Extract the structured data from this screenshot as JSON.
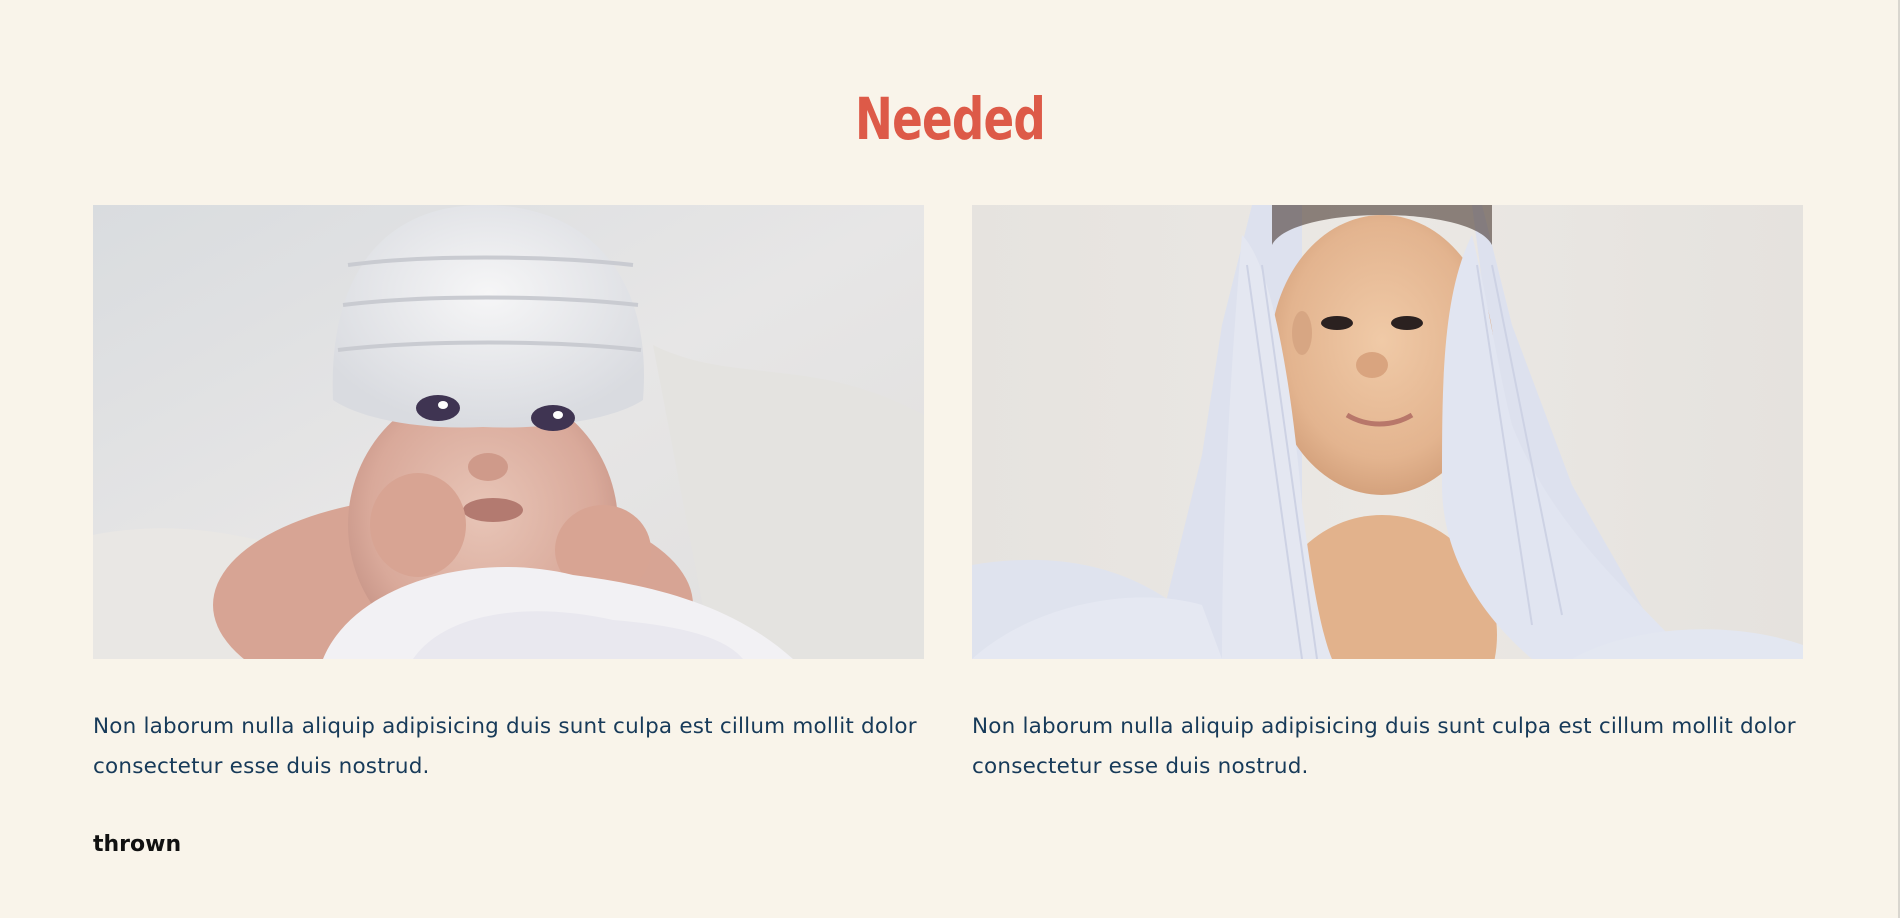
{
  "page": {
    "background": "#f9f4ea",
    "accent": "#dd5a48",
    "text_color": "#173a59"
  },
  "header": {
    "title": "Needed"
  },
  "cards": [
    {
      "image": "baby-in-white-knit-hat-photo",
      "caption": "Non laborum nulla aliquip adipisicing duis sunt culpa est cillum mollit dolor consectetur esse duis nostrud."
    },
    {
      "image": "smiling-baby-under-blanket-photo",
      "caption": "Non laborum nulla aliquip adipisicing duis sunt culpa est cillum mollit dolor consectetur esse duis nostrud."
    }
  ],
  "footer": {
    "label": "thrown"
  }
}
